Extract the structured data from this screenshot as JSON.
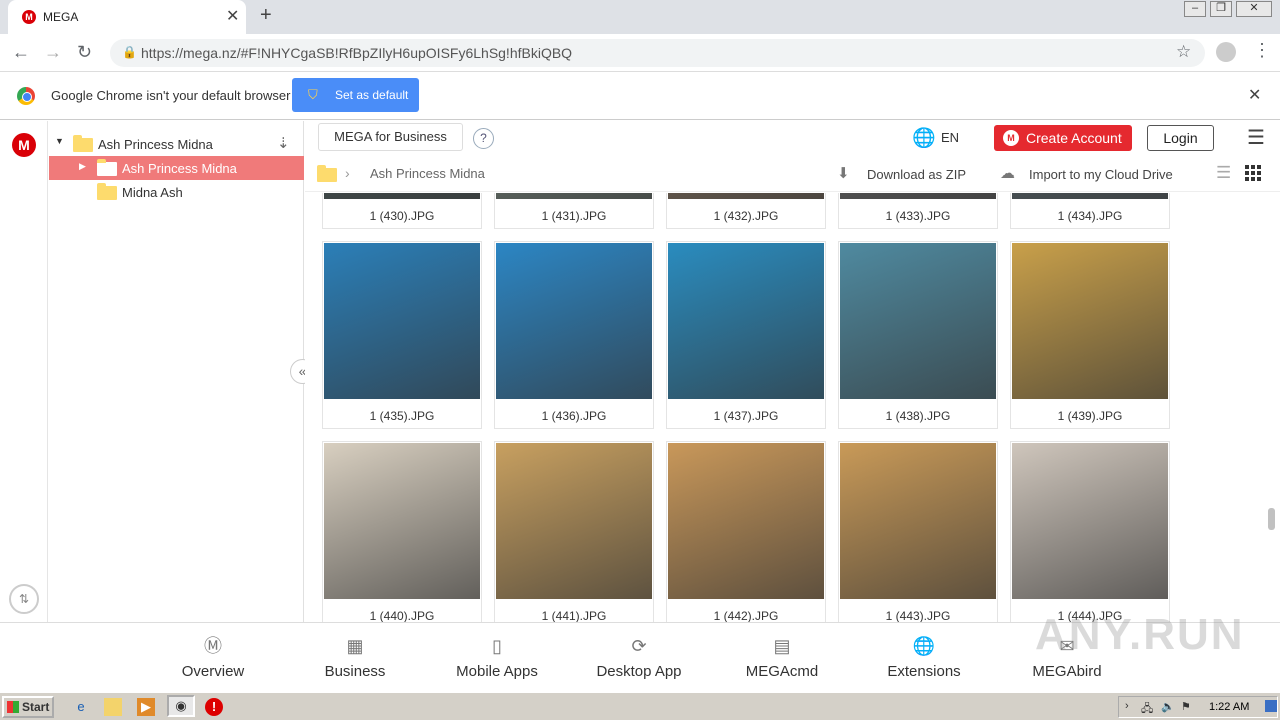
{
  "browser": {
    "tab_title": "MEGA",
    "tab_logo": "M",
    "url": "https://mega.nz/#F!NHYCgaSB!RfBpZIlyH6upOISFy6LhSg!hfBkiQBQ",
    "infobar_text": "Google Chrome isn't your default browser",
    "set_default_label": "Set as default"
  },
  "rail": {
    "logo": "M"
  },
  "tree": {
    "root": "Ash Princess Midna",
    "items": [
      "Ash Princess Midna",
      "Midna Ash"
    ]
  },
  "header": {
    "business_label": "MEGA for Business",
    "help": "?",
    "lang": "EN",
    "create_label": "Create Account",
    "login_label": "Login"
  },
  "breadcrumb": {
    "folder": "Ash Princess Midna",
    "download_label": "Download as ZIP",
    "import_label": "Import to my Cloud Drive"
  },
  "files": [
    {
      "name": "1 (430).JPG",
      "color": "#4a5a5a"
    },
    {
      "name": "1 (431).JPG",
      "color": "#7a8a80"
    },
    {
      "name": "1 (432).JPG",
      "color": "#8a7560"
    },
    {
      "name": "1 (433).JPG",
      "color": "#6a6a6a"
    },
    {
      "name": "1 (434).JPG",
      "color": "#5a6a70"
    },
    {
      "name": "1 (435).JPG",
      "color": "#2b7fb8"
    },
    {
      "name": "1 (436).JPG",
      "color": "#2c86c4"
    },
    {
      "name": "1 (437).JPG",
      "color": "#2a8cbf"
    },
    {
      "name": "1 (438).JPG",
      "color": "#4f8aa0"
    },
    {
      "name": "1 (439).JPG",
      "color": "#c9a04a"
    },
    {
      "name": "1 (440).JPG",
      "color": "#d8cfc0"
    },
    {
      "name": "1 (441).JPG",
      "color": "#c8a060"
    },
    {
      "name": "1 (442).JPG",
      "color": "#c9985a"
    },
    {
      "name": "1 (443).JPG",
      "color": "#c99a58"
    },
    {
      "name": "1 (444).JPG",
      "color": "#cfc6bc"
    }
  ],
  "footer": {
    "items": [
      "Overview",
      "Business",
      "Mobile Apps",
      "Desktop App",
      "MEGAcmd",
      "Extensions",
      "MEGAbird"
    ]
  },
  "watermark": "ANY.RUN",
  "taskbar": {
    "start": "Start",
    "clock": "1:22 AM"
  }
}
